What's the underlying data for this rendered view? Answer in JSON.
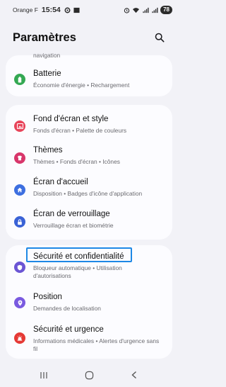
{
  "status": {
    "carrier": "Orange F",
    "time": "15:54",
    "battery": "78"
  },
  "header": {
    "title": "Paramètres"
  },
  "cut_item_sub": "navigation",
  "items": [
    {
      "title": "Batterie",
      "sub": "Économie d'énergie • Rechargement",
      "color": "#34a853",
      "icon": "battery-icon"
    },
    {
      "title": "Fond d'écran et style",
      "sub": "Fonds d'écran • Palette de couleurs",
      "color": "#e8445a",
      "icon": "wallpaper-icon"
    },
    {
      "title": "Thèmes",
      "sub": "Thèmes • Fonds d'écran • Icônes",
      "color": "#d8366b",
      "icon": "themes-icon"
    },
    {
      "title": "Écran d'accueil",
      "sub": "Disposition • Badges d'icône d'application",
      "color": "#3d6fe0",
      "icon": "home-icon"
    },
    {
      "title": "Écran de verrouillage",
      "sub": "Verrouillage écran et biométrie",
      "color": "#3a62d6",
      "icon": "lock-icon"
    },
    {
      "title": "Sécurité et confidentialité",
      "sub": "Bloqueur automatique • Utilisation d'autorisations",
      "color": "#6b55d4",
      "icon": "shield-icon"
    },
    {
      "title": "Position",
      "sub": "Demandes de localisation",
      "color": "#7a5ae0",
      "icon": "location-icon"
    },
    {
      "title": "Sécurité et urgence",
      "sub": "Informations médicales • Alertes d'urgence sans fil",
      "color": "#e53935",
      "icon": "emergency-icon"
    }
  ]
}
